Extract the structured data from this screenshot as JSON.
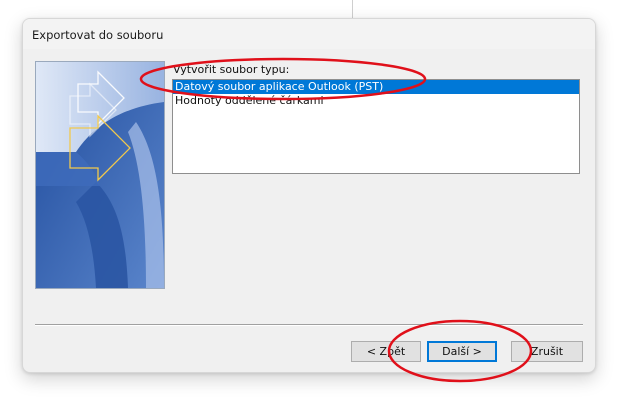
{
  "window": {
    "title": "Exportovat do souboru"
  },
  "list": {
    "label": "Vytvořit soubor typu:",
    "items": [
      {
        "label": "Datový soubor aplikace Outlook (PST)",
        "selected": true
      },
      {
        "label": "Hodnoty oddělené čárkami",
        "selected": false
      }
    ]
  },
  "buttons": {
    "back": "< Zpět",
    "next": "Další >",
    "cancel": "Zrušit"
  },
  "colors": {
    "selection": "#0078d7",
    "annotation": "#e0101a"
  },
  "icons": [
    "export-wizard-banner-icon"
  ]
}
